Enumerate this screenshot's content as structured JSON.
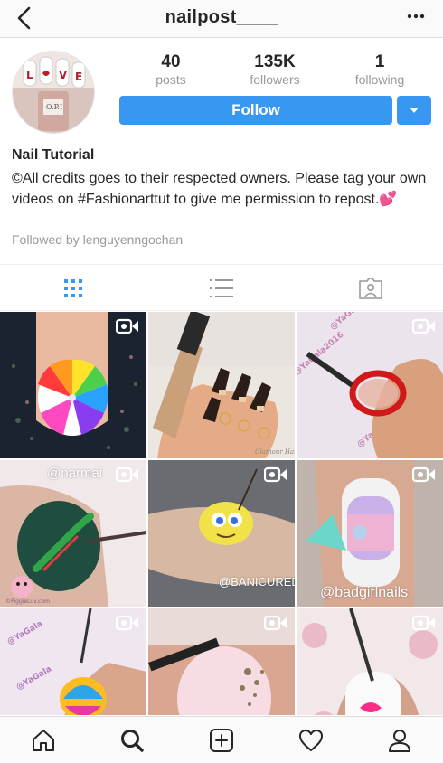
{
  "header": {
    "username": "nailpost____",
    "back_icon": "chevron-left-icon",
    "more_icon": "more-horizontal-icon"
  },
  "stats": {
    "posts": {
      "value": "40",
      "label": "posts"
    },
    "followers": {
      "value": "135K",
      "label": "followers"
    },
    "following": {
      "value": "1",
      "label": "following"
    }
  },
  "actions": {
    "follow_label": "Follow",
    "dropdown_icon": "caret-down-icon",
    "accent": "#3897f0"
  },
  "bio": {
    "name": "Nail Tutorial",
    "text": "©All credits goes to their respected owners. Please tag your own videos on #Fashionarttut to give me permission to repost.💕",
    "followed_by": "Followed by lenguyenngochan"
  },
  "tabs": [
    {
      "name": "grid-view",
      "icon": "grid-icon",
      "active": true
    },
    {
      "name": "list-view",
      "icon": "list-icon",
      "active": false
    },
    {
      "name": "tagged",
      "icon": "tagged-icon",
      "active": false
    }
  ],
  "posts": [
    {
      "type": "video",
      "overlay": ""
    },
    {
      "type": "image",
      "overlay": "Glamour Haze"
    },
    {
      "type": "video",
      "overlay": "@YaGala2016 @YaGala2016"
    },
    {
      "type": "video",
      "overlay": "@narmai"
    },
    {
      "type": "video",
      "overlay": "@BANICURED_"
    },
    {
      "type": "video",
      "overlay": "@badgirlnails"
    },
    {
      "type": "video",
      "overlay": "@YaGala"
    },
    {
      "type": "video",
      "overlay": ""
    },
    {
      "type": "video",
      "overlay": ""
    }
  ],
  "watermark_small": "©PiggieLuv.com",
  "bottom_nav": [
    {
      "name": "home",
      "icon": "home-icon"
    },
    {
      "name": "search",
      "icon": "search-icon",
      "active": true
    },
    {
      "name": "new-post",
      "icon": "plus-square-icon"
    },
    {
      "name": "activity",
      "icon": "heart-icon"
    },
    {
      "name": "profile",
      "icon": "person-icon"
    }
  ]
}
